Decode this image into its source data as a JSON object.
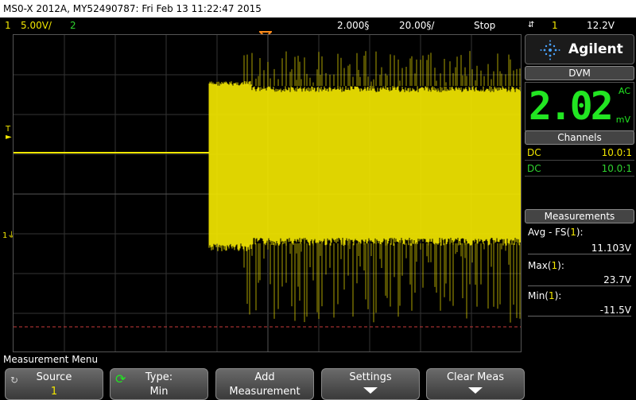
{
  "title": "MS0-X 2012A, MY52490787: Fri Feb 13 11:22:47 2015",
  "status": {
    "ch1_num": "1",
    "ch1_scale": "5.00V/",
    "ch2_num": "2",
    "timebase": "2.000§",
    "delay": "20.00§/",
    "run_state": "Stop",
    "trigger_icon": "trigger-edge-icon",
    "trig_source": "1",
    "trig_level": "12.2V"
  },
  "markers": {
    "trigger_level_marker": "T",
    "ch1_ground_marker": "1"
  },
  "brand": "Agilent",
  "dvm": {
    "header": "DVM",
    "value": "2.02",
    "mode": "AC",
    "unit": "mV"
  },
  "channels": {
    "header": "Channels",
    "rows": [
      {
        "coupling": "DC",
        "probe": "10.0:1",
        "color": "#f2e600"
      },
      {
        "coupling": "DC",
        "probe": "10.0:1",
        "color": "#2fd32f"
      }
    ]
  },
  "measurements": {
    "header": "Measurements",
    "items": [
      {
        "label_main": "Avg - FS(",
        "label_ch": "1",
        "label_end": "):",
        "value": "11.103V"
      },
      {
        "label_main": "Max(",
        "label_ch": "1",
        "label_end": "):",
        "value": "23.7V"
      },
      {
        "label_main": "Min(",
        "label_ch": "1",
        "label_end": "):",
        "value": "-11.5V"
      }
    ]
  },
  "menu": {
    "title": "Measurement Menu",
    "softkeys": [
      {
        "line1": "Source",
        "line2": "1"
      },
      {
        "line1": "Type:",
        "line2": "Min"
      },
      {
        "line1": "Add",
        "line2": "Measurement"
      },
      {
        "line1": "Settings",
        "line2": ""
      },
      {
        "line1": "Clear Meas",
        "line2": ""
      }
    ]
  },
  "colors": {
    "ch1": "#f2e600",
    "ch2": "#2fd32f",
    "dvm": "#22e622",
    "ref_line": "#c83a3a",
    "trigger_marker": "#ff8c1a"
  }
}
